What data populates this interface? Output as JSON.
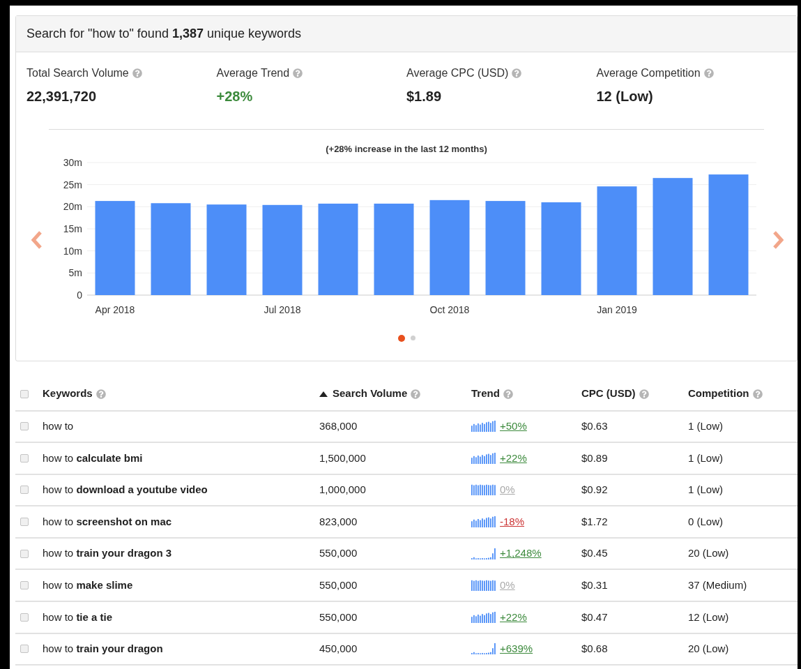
{
  "summary": {
    "title": "Search for \"how to\" found **1,387** unique keywords"
  },
  "stats": [
    {
      "label": "Total Search Volume",
      "value": "22,391,720",
      "color": "#222222"
    },
    {
      "label": "Average Trend",
      "value": "+28%",
      "color": "#3c8a3c"
    },
    {
      "label": "Average CPC (USD)",
      "value": "$1.89",
      "color": "#222222"
    },
    {
      "label": "Average Competition",
      "value": "12 (Low)",
      "color": "#222222"
    }
  ],
  "chart": {
    "chart_data": {
      "type": "bar",
      "title": "(+28% increase in the last 12 months)",
      "categories": [
        "Apr 2018",
        null,
        null,
        "Jul 2018",
        null,
        null,
        "Oct 2018",
        null,
        null,
        "Jan 2019",
        null,
        null
      ],
      "series": [
        {
          "color": "#4d8ef8",
          "values": [
            21.3,
            20.8,
            20.5,
            20.4,
            20.7,
            20.7,
            21.5,
            21.3,
            21.0,
            24.6,
            26.5,
            27.3
          ]
        }
      ],
      "ylim": [
        0,
        30
      ],
      "grid": true,
      "yticks": [
        {
          "value": 0,
          "label": "0"
        },
        {
          "value": 5,
          "label": "5m"
        },
        {
          "value": 10,
          "label": "10m"
        },
        {
          "value": 15,
          "label": "15m"
        },
        {
          "value": 20,
          "label": "20m"
        },
        {
          "value": 25,
          "label": "25m"
        },
        {
          "value": 30,
          "label": "30m"
        }
      ]
    },
    "pages": [
      {
        "selected": true
      },
      {
        "selected": false
      }
    ]
  },
  "table": {
    "select_all": {
      "checked": false
    },
    "columns": [
      {
        "label": "Keywords",
        "sorted": false
      },
      {
        "label": "Search Volume",
        "sorted": true
      },
      {
        "label": "Trend",
        "sorted": false
      },
      {
        "label": "CPC (USD)",
        "sorted": false
      },
      {
        "label": "Competition",
        "sorted": false
      }
    ],
    "rows": [
      {
        "checked": false,
        "keyword": "how to",
        "volume": "368,000",
        "trend": {
          "kind": "steady",
          "color": "#3c8a3c",
          "value": "+50%"
        },
        "cpc": "$0.63",
        "competition": "1 (Low)"
      },
      {
        "checked": false,
        "keyword": "how to **calculate bmi**",
        "volume": "1,500,000",
        "trend": {
          "kind": "steady",
          "color": "#3c8a3c",
          "value": "+22%"
        },
        "cpc": "$0.89",
        "competition": "1 (Low)"
      },
      {
        "checked": false,
        "keyword": "how to **download a youtube video**",
        "volume": "1,000,000",
        "trend": {
          "kind": "flat",
          "color": "#aaaaaa",
          "value": "0%"
        },
        "cpc": "$0.92",
        "competition": "1 (Low)"
      },
      {
        "checked": false,
        "keyword": "how to **screenshot on mac**",
        "volume": "823,000",
        "trend": {
          "kind": "steady",
          "color": "#cc3333",
          "value": "-18%"
        },
        "cpc": "$1.72",
        "competition": "0 (Low)"
      },
      {
        "checked": false,
        "keyword": "how to **train your dragon 3**",
        "volume": "550,000",
        "trend": {
          "kind": "surge",
          "color": "#3c8a3c",
          "value": "+1,248%"
        },
        "cpc": "$0.45",
        "competition": "20 (Low)"
      },
      {
        "checked": false,
        "keyword": "how to **make slime**",
        "volume": "550,000",
        "trend": {
          "kind": "flat",
          "color": "#aaaaaa",
          "value": "0%"
        },
        "cpc": "$0.31",
        "competition": "37 (Medium)"
      },
      {
        "checked": false,
        "keyword": "how to **tie a tie**",
        "volume": "550,000",
        "trend": {
          "kind": "steady",
          "color": "#3c8a3c",
          "value": "+22%"
        },
        "cpc": "$0.47",
        "competition": "12 (Low)"
      },
      {
        "checked": false,
        "keyword": "how to **train your dragon**",
        "volume": "450,000",
        "trend": {
          "kind": "surge",
          "color": "#3c8a3c",
          "value": "+639%"
        },
        "cpc": "$0.68",
        "competition": "20 (Low)"
      }
    ]
  }
}
